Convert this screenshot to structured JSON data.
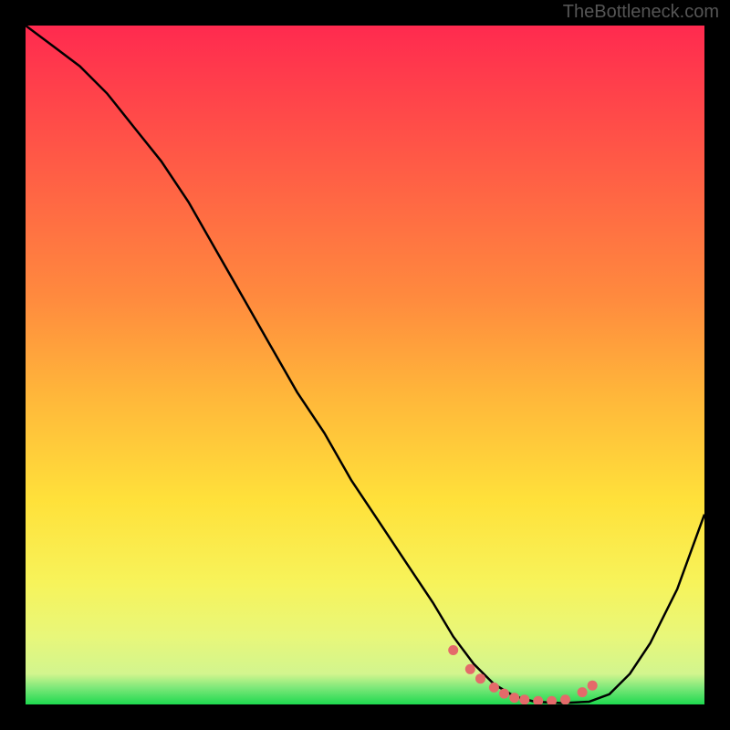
{
  "watermark": "TheBottleneck.com",
  "chart_data": {
    "type": "line",
    "title": "",
    "xlabel": "",
    "ylabel": "",
    "xlim": [
      0,
      100
    ],
    "ylim": [
      0,
      100
    ],
    "series": [
      {
        "name": "curve",
        "x": [
          0,
          4,
          8,
          12,
          16,
          20,
          24,
          28,
          32,
          36,
          40,
          44,
          48,
          52,
          56,
          60,
          63,
          66,
          69,
          72,
          75,
          79,
          83,
          86,
          89,
          92,
          96,
          100
        ],
        "y": [
          100,
          97,
          94,
          90,
          85,
          80,
          74,
          67,
          60,
          53,
          46,
          40,
          33,
          27,
          21,
          15,
          10,
          6,
          3,
          1.2,
          0.4,
          0.2,
          0.4,
          1.5,
          4.5,
          9,
          17,
          28
        ]
      },
      {
        "name": "dots",
        "x": [
          63,
          65.5,
          67,
          69,
          70.5,
          72,
          73.5,
          75.5,
          77.5,
          79.5,
          82,
          83.5
        ],
        "y": [
          8.0,
          5.2,
          3.8,
          2.5,
          1.6,
          1.0,
          0.7,
          0.5,
          0.5,
          0.7,
          1.8,
          2.8
        ]
      }
    ],
    "gradient_stops": [
      {
        "offset": 0.0,
        "color": "#ff2a4f"
      },
      {
        "offset": 0.2,
        "color": "#ff5a46"
      },
      {
        "offset": 0.4,
        "color": "#ff8a3e"
      },
      {
        "offset": 0.55,
        "color": "#ffb83a"
      },
      {
        "offset": 0.7,
        "color": "#ffe13a"
      },
      {
        "offset": 0.82,
        "color": "#f7f35a"
      },
      {
        "offset": 0.9,
        "color": "#e8f77a"
      },
      {
        "offset": 0.955,
        "color": "#d2f58e"
      },
      {
        "offset": 0.975,
        "color": "#7fe87a"
      },
      {
        "offset": 1.0,
        "color": "#1ed94f"
      }
    ],
    "dot_color": "#e46a6a",
    "curve_color": "#000000"
  }
}
